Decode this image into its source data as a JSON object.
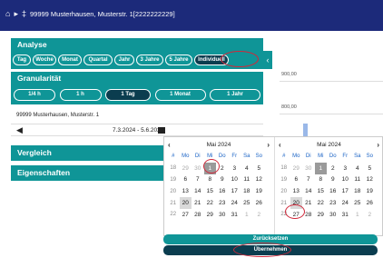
{
  "topbar": {
    "breadcrumb": "99999 Musterhausen, Musterstr. 1[2222222229]"
  },
  "analyse": {
    "title": "Analyse",
    "periods": [
      "Tag",
      "Woche",
      "Monat",
      "Quartal",
      "Jahr",
      "3 Jahre",
      "5 Jahre",
      "Individuell"
    ],
    "selected_period": "Individuell"
  },
  "granularitaet": {
    "title": "Granularität",
    "options": [
      "1/4 h",
      "1 h",
      "1 Tag",
      "1 Monat",
      "1 Jahr"
    ],
    "selected": "1 Tag"
  },
  "location": {
    "address": "99999 Musterhausen, Musterstr. 1"
  },
  "daterange": {
    "range": "7.3.2024 - 5.6.2024"
  },
  "sections": {
    "vergleich": "Vergleich",
    "eigenschaften": "Eigenschaften"
  },
  "chart": {
    "y_ticks": [
      "900,00",
      "800,00"
    ]
  },
  "calendar": {
    "weekday_header": [
      "#",
      "Mo",
      "Di",
      "Mi",
      "Do",
      "Fr",
      "Sa",
      "So"
    ],
    "left": {
      "title": "Mai 2024",
      "rows": [
        [
          "18",
          "29",
          "30",
          "1",
          "2",
          "3",
          "4",
          "5"
        ],
        [
          "19",
          "6",
          "7",
          "8",
          "9",
          "10",
          "11",
          "12"
        ],
        [
          "20",
          "13",
          "14",
          "15",
          "16",
          "17",
          "18",
          "19"
        ],
        [
          "21",
          "20",
          "21",
          "22",
          "23",
          "24",
          "25",
          "26"
        ],
        [
          "22",
          "27",
          "28",
          "29",
          "30",
          "31",
          "1",
          "2"
        ]
      ],
      "selected_day": "1",
      "today_day": "20"
    },
    "right": {
      "title": "Mai 2024",
      "rows": [
        [
          "18",
          "29",
          "30",
          "1",
          "2",
          "3",
          "4",
          "5"
        ],
        [
          "19",
          "6",
          "7",
          "8",
          "9",
          "10",
          "11",
          "12"
        ],
        [
          "20",
          "13",
          "14",
          "15",
          "16",
          "17",
          "18",
          "19"
        ],
        [
          "21",
          "20",
          "21",
          "22",
          "23",
          "24",
          "25",
          "26"
        ],
        [
          "22",
          "27",
          "28",
          "29",
          "30",
          "31",
          "1",
          "2"
        ]
      ],
      "selected_day": "1",
      "highlighted_day": "20"
    },
    "reset_label": "Zurücksetzen",
    "apply_label": "Übernehmen"
  }
}
